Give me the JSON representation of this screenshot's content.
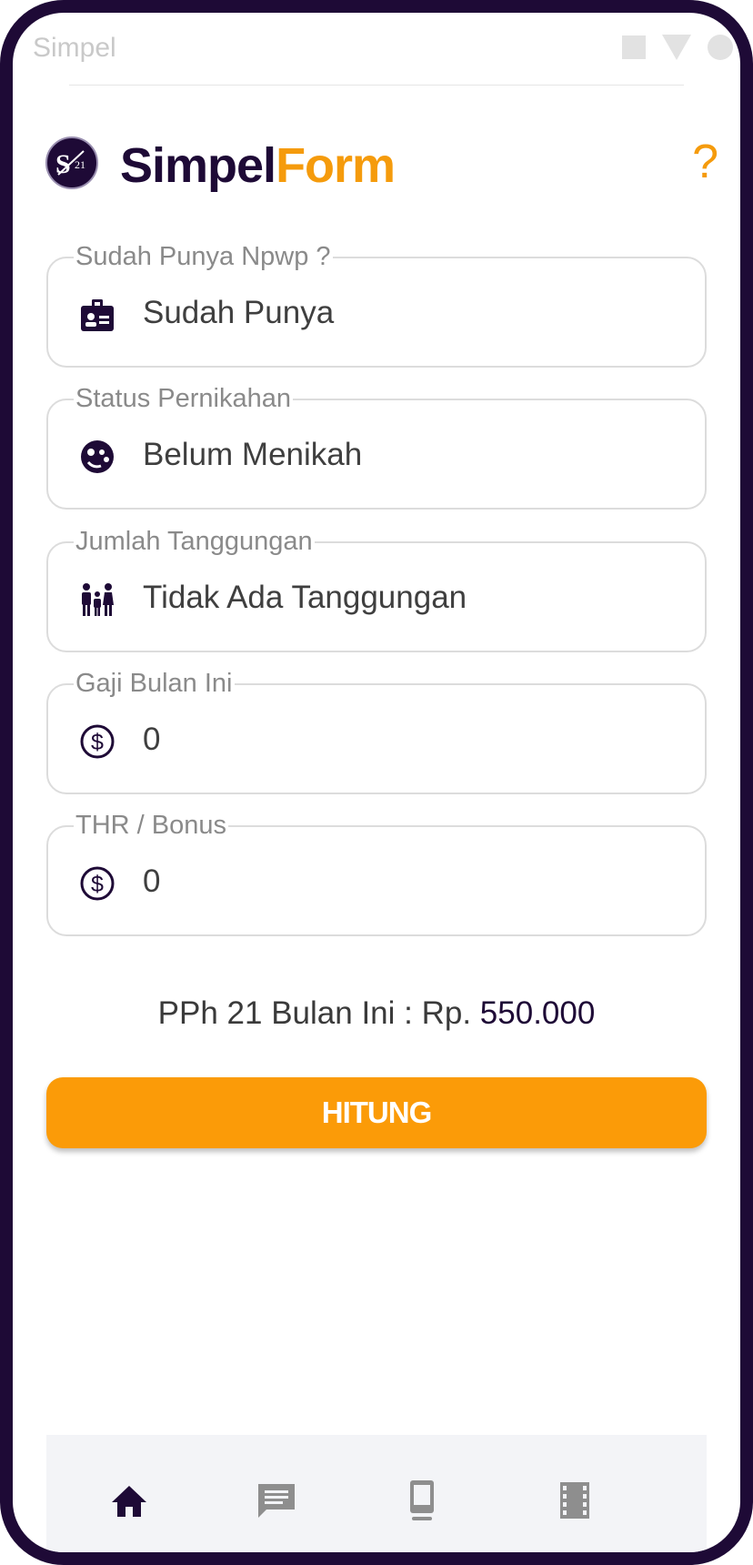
{
  "statusbar": {
    "title": "Simpel"
  },
  "header": {
    "logo_badge_text": "S21",
    "brand_primary": "Simpel",
    "brand_accent": "Form",
    "help_icon": "question-mark-icon",
    "help_symbol": "?"
  },
  "form": {
    "fields": [
      {
        "label": "Sudah Punya Npwp ?",
        "value": "Sudah Punya",
        "icon": "id-badge-icon"
      },
      {
        "label": "Status Pernikahan",
        "value": "Belum Menikah",
        "icon": "marital-face-icon"
      },
      {
        "label": "Jumlah Tanggungan",
        "value": "Tidak Ada Tanggungan",
        "icon": "family-icon"
      },
      {
        "label": "Gaji Bulan Ini",
        "value": "0",
        "icon": "dollar-circle-icon"
      },
      {
        "label": "THR / Bonus",
        "value": "0",
        "icon": "dollar-circle-icon"
      }
    ]
  },
  "result": {
    "label": "PPh 21 Bulan Ini : Rp.",
    "amount": "550.000"
  },
  "actions": {
    "hitung_label": "HITUNG"
  },
  "bottom_nav": {
    "items": [
      {
        "icon": "home-icon",
        "active": true
      },
      {
        "icon": "message-icon",
        "active": false
      },
      {
        "icon": "phone-device-icon",
        "active": false
      },
      {
        "icon": "film-icon",
        "active": false
      }
    ]
  },
  "colors": {
    "primary": "#1e0a36",
    "accent": "#f59b0c",
    "button": "#fb9b08",
    "nav_inactive": "#8e8e8e"
  }
}
